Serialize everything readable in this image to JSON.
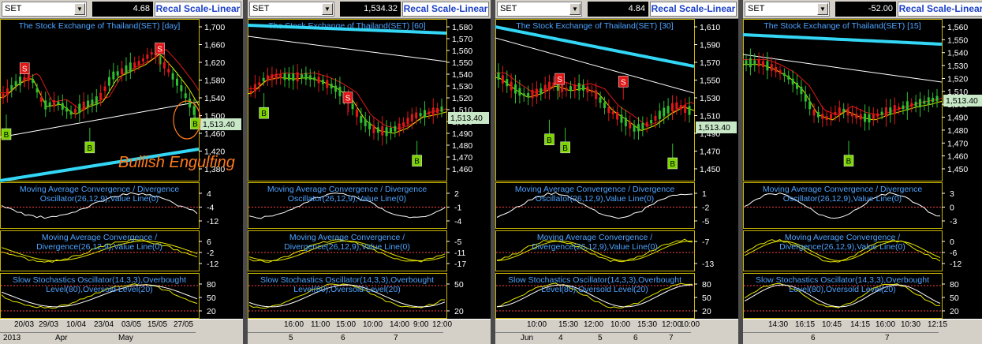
{
  "panes": [
    {
      "symbol": "SET",
      "value": "4.68",
      "recal": "Recal Scale-Linear",
      "title": "The Stock Exchange of Thailand(SET) [day]",
      "price_ticks": [
        "1,700",
        "1,660",
        "1,620",
        "1,580",
        "1,540",
        "1,500",
        "1,460",
        "1,420",
        "1,380"
      ],
      "last": "1,513.40",
      "annotation": "Bullish Engulfing",
      "macd1_title": [
        "Moving Average Convergence / Divergence",
        "Oscillator(26,12,9),Value Line(0)"
      ],
      "macd1_ticks": [
        "4",
        "-4",
        "-12"
      ],
      "macd2_title": [
        "Moving Average Convergence /",
        "Divergence(26,12,9),Value Line(0)"
      ],
      "macd2_ticks": [
        "6",
        "-2",
        "-12"
      ],
      "stoch_title": [
        "Slow Stochastics Oscillator(14,3,3),Overbought",
        "Level(80),Oversold Level(20)"
      ],
      "stoch_ticks": [
        "80",
        "50",
        "20"
      ],
      "time_row1": [
        "20/03",
        "29/03",
        "10/04",
        "23/04",
        "03/05",
        "15/05",
        "27/05"
      ],
      "time_row2": [
        "2013",
        "Apr",
        "May"
      ],
      "signals_s": [
        "S",
        "S"
      ],
      "signals_b": [
        "B",
        "B",
        "B"
      ]
    },
    {
      "symbol": "SET",
      "value": "1,534.32",
      "recal": "Recal Scale-Linear",
      "title": "The Stock Exchange of Thailand(SET) [60]",
      "price_ticks": [
        "1,580",
        "1,570",
        "1,560",
        "1,550",
        "1,540",
        "1,530",
        "1,520",
        "1,510",
        "1,500",
        "1,490",
        "1,480",
        "1,470",
        "1,460"
      ],
      "last": "1,513.40",
      "annotation": "",
      "macd1_title": [
        "Moving Average Convergence / Divergence",
        "Oscillator(26,12,9),Value Line(0)"
      ],
      "macd1_ticks": [
        "2",
        "-1",
        "-4"
      ],
      "macd2_title": [
        "Moving Average Convergence /",
        "Divergence(26,12,9),Value Line(0)"
      ],
      "macd2_ticks": [
        "-5",
        "-11",
        "-17"
      ],
      "stoch_title": [
        "Slow Stochastics Oscillator(14,3,3),Overbought",
        "Level(80),Oversold Level(20)"
      ],
      "stoch_ticks": [
        "50",
        "20"
      ],
      "time_row1": [
        "16:00",
        "11:00",
        "15:00",
        "10:00",
        "14:00",
        "9:00",
        "12:00"
      ],
      "time_row2": [
        "5",
        "6",
        "7"
      ],
      "signals_s": [
        "S"
      ],
      "signals_b": [
        "B",
        "B"
      ]
    },
    {
      "symbol": "SET",
      "value": "4.84",
      "recal": "Recal Scale-Linear",
      "title": "The Stock Exchange of Thailand(SET) [30]",
      "price_ticks": [
        "1,610",
        "1,590",
        "1,570",
        "1,550",
        "1,530",
        "1,510",
        "1,490",
        "1,470",
        "1,450"
      ],
      "last": "1,513.40",
      "annotation": "",
      "macd1_title": [
        "Moving Average Convergence / Divergence",
        "Oscillator(26,12,9),Value Line(0)"
      ],
      "macd1_ticks": [
        "1",
        "-2",
        "-5"
      ],
      "macd2_title": [
        "Moving Average Convergence /",
        "Divergence(26,12,9),Value Line(0)"
      ],
      "macd2_ticks": [
        "-7",
        "-13"
      ],
      "stoch_title": [
        "Slow Stochastics Oscillator(14,3,3),Overbought",
        "Level(80),Oversold Level(20)"
      ],
      "stoch_ticks": [
        "80",
        "50",
        "20"
      ],
      "time_row1": [
        "10:00",
        "15:30",
        "12:00",
        "10:00",
        "15:30",
        "12:00",
        "10:00"
      ],
      "time_row2": [
        "Jun",
        "4",
        "5",
        "6",
        "7"
      ],
      "signals_s": [
        "S",
        "S"
      ],
      "signals_b": [
        "B",
        "B",
        "B"
      ]
    },
    {
      "symbol": "SET",
      "value": "-52.00",
      "recal": "Recal Scale-Linear",
      "title": "The Stock Exchange of Thailand(SET) [15]",
      "price_ticks": [
        "1,560",
        "1,550",
        "1,540",
        "1,530",
        "1,520",
        "1,510",
        "1,500",
        "1,490",
        "1,480",
        "1,470",
        "1,460",
        "1,450"
      ],
      "last": "1,513.40",
      "annotation": "",
      "macd1_title": [
        "Moving Average Convergence / Divergence",
        "Oscillator(26,12,9),Value Line(0)"
      ],
      "macd1_ticks": [
        "3",
        "0",
        "-3"
      ],
      "macd2_title": [
        "Moving Average Convergence /",
        "Divergence(26,12,9),Value Line(0)"
      ],
      "macd2_ticks": [
        "0",
        "-6",
        "-12"
      ],
      "stoch_title": [
        "Slow Stochastics Oscillator(14,3,3),Overbought",
        "Level(80),Oversold Level(20)"
      ],
      "stoch_ticks": [
        "80",
        "50",
        "20"
      ],
      "time_row1": [
        "14:30",
        "16:15",
        "10:45",
        "14:15",
        "16:00",
        "10:30",
        "12:15"
      ],
      "time_row2": [
        "6",
        "7"
      ],
      "signals_s": [],
      "signals_b": [
        "B"
      ]
    }
  ],
  "colors": {
    "up": "#2fbf2f",
    "down": "#e01818",
    "ma_fast": "#e6e600",
    "ma_mid": "#e01818",
    "ma_slow": "#ffffff",
    "ma_long": "#33d6f5",
    "title": "#4da3ff",
    "annotation": "#ff7b1a",
    "panel_border": "#c8b400"
  }
}
